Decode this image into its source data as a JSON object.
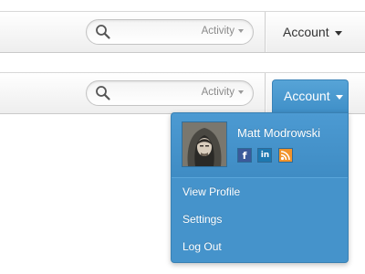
{
  "navbar_closed": {
    "search": {
      "placeholder": "",
      "scope_label": "Activity"
    },
    "account_label": "Account"
  },
  "navbar_open": {
    "search": {
      "placeholder": "",
      "scope_label": "Activity"
    },
    "account_label": "Account"
  },
  "dropdown": {
    "user_name": "Matt Modrowski",
    "socials": [
      "facebook-icon",
      "linkedin-icon",
      "rss-icon"
    ],
    "menu": [
      "View Profile",
      "Settings",
      "Log Out"
    ]
  },
  "colors": {
    "accent": "#4593cb",
    "accent_dark": "#3a80b2",
    "text": "#333333"
  }
}
